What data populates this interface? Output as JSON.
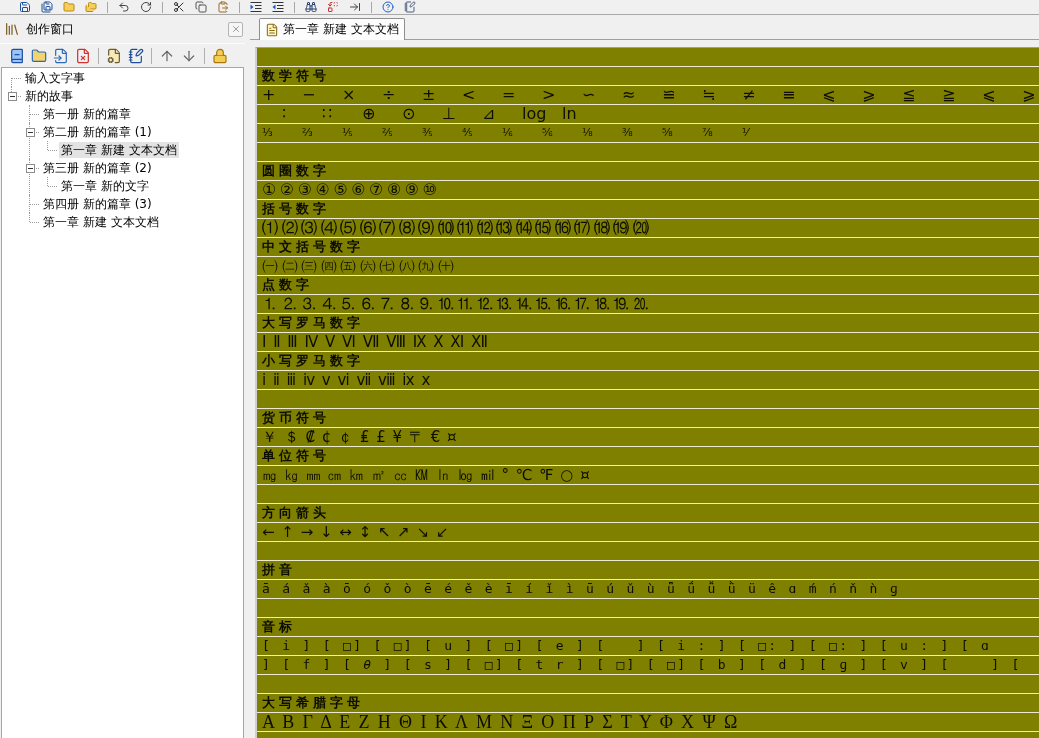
{
  "sidebar": {
    "title": "创作窗口",
    "tree": [
      {
        "label": "输入文字事",
        "selected": false
      },
      {
        "label": "新的故事",
        "selected": false,
        "expanded": true,
        "children": [
          {
            "label": "第一册 新的篇章",
            "selected": false
          },
          {
            "label": "第二册 新的篇章 (1)",
            "selected": false,
            "expanded": true,
            "children": [
              {
                "label": "第一章 新建 文本文档",
                "selected": true
              }
            ]
          },
          {
            "label": "第三册 新的篇章 (2)",
            "selected": false,
            "expanded": true,
            "children": [
              {
                "label": "第一章 新的文字",
                "selected": false
              }
            ]
          },
          {
            "label": "第四册 新的篇章 (3)",
            "selected": false
          },
          {
            "label": "第一章 新建 文本文档",
            "selected": false
          }
        ]
      }
    ]
  },
  "tabs": [
    {
      "label": "第一章 新建 文本文档",
      "selected": true
    }
  ],
  "document": {
    "lines": [
      {
        "kind": "blank"
      },
      {
        "kind": "heading",
        "text": "数学符号"
      },
      {
        "kind": "symbols",
        "items": [
          "+",
          "−",
          "×",
          "÷",
          "±",
          "<",
          "=",
          ">",
          "∽",
          "≈",
          "≌",
          "≒",
          "≠",
          "≡",
          "⩽",
          "⩾",
          "≦",
          "≧",
          "⩽",
          "⩾"
        ]
      },
      {
        "kind": "symbols-shifted",
        "items": [
          "∶",
          "∷",
          "⊕",
          "⊙",
          "⊥",
          "⊿",
          "log",
          "ln"
        ]
      },
      {
        "kind": "fractions",
        "items": [
          "⅓",
          "⅔",
          "⅕",
          "⅖",
          "⅗",
          "⅘",
          "⅙",
          "⅚",
          "⅛",
          "⅜",
          "⅝",
          "⅞",
          "⅟"
        ]
      },
      {
        "kind": "blank"
      },
      {
        "kind": "heading",
        "text": "圆圈数字"
      },
      {
        "kind": "glyphs",
        "text": "①②③④⑤⑥⑦⑧⑨⑩"
      },
      {
        "kind": "heading",
        "text": "括号数字"
      },
      {
        "kind": "glyphs",
        "text": "⑴⑵⑶⑷⑸⑹⑺⑻⑼⑽⑾⑿⒀⒁⒂⒃⒄⒅⒆⒇"
      },
      {
        "kind": "heading",
        "text": "中文括号数字"
      },
      {
        "kind": "glyphs",
        "text": "㈠㈡㈢㈣㈤㈥㈦㈧㈨㈩"
      },
      {
        "kind": "heading",
        "text": "点数字"
      },
      {
        "kind": "glyphs",
        "text": "⒈⒉⒊⒋⒌⒍⒎⒏⒐⒑⒒⒓⒔⒕⒖⒗⒘⒙⒚⒛"
      },
      {
        "kind": "heading",
        "text": "大写罗马数字"
      },
      {
        "kind": "spaced-glyphs",
        "text": "Ⅰ Ⅱ Ⅲ Ⅳ Ⅴ Ⅵ Ⅶ Ⅷ Ⅸ Ⅹ Ⅺ Ⅻ"
      },
      {
        "kind": "heading",
        "text": "小写罗马数字"
      },
      {
        "kind": "spaced-glyphs",
        "text": "ⅰ ⅱ ⅲ ⅳ ⅴ ⅵ ⅶ ⅷ ⅸ ⅹ"
      },
      {
        "kind": "blank"
      },
      {
        "kind": "heading",
        "text": "货币符号"
      },
      {
        "kind": "spaced-glyphs",
        "text": "￥ ＄ ₡ ¢ ￠ ₤ £ ¥ 〒 € ¤"
      },
      {
        "kind": "heading",
        "text": "单位符号"
      },
      {
        "kind": "spaced-glyphs",
        "text": "㎎ ㎏ ㎜ ㎝ ㎞ ㎡ ㏄ ㏎ ㏑ ㏒ ㏕ ° ℃ ℉ ○ ¤"
      },
      {
        "kind": "blank"
      },
      {
        "kind": "heading",
        "text": "方向箭头"
      },
      {
        "kind": "spaced-glyphs",
        "text": "← ↑ → ↓ ↔ ↕ ↖ ↗ ↘ ↙"
      },
      {
        "kind": "blank"
      },
      {
        "kind": "heading",
        "text": "拼音"
      },
      {
        "kind": "mono",
        "text": "ā á ǎ à ō ó ǒ ò ē é ě è ī í ǐ ì ū ú ǔ ù ǖ ǘ ǚ ǜ ü ê ɑ ḿ ń ň ǹ ɡ"
      },
      {
        "kind": "blank"
      },
      {
        "kind": "heading",
        "text": "音标"
      },
      {
        "kind": "mono",
        "text": "[ i ] [ □] [ □] [ u ] [ □] [ e ] [   ] [ i : ] [ □: ] [ □: ] [ u : ] [ ɑ"
      },
      {
        "kind": "mono",
        "text": "] [ f ] [ *θ* ] [ s ] [ □] [ t r ] [ □] [ □] [ b ] [ d ] [ ɡ ] [ v ] [    ] ["
      },
      {
        "kind": "blank"
      },
      {
        "kind": "heading",
        "text": "大写希腊字母"
      },
      {
        "kind": "greek",
        "text": "Α Β Γ Δ Ε Ζ Η Θ Ι Κ Λ Μ Ν Ξ Ο Π Ρ Σ Τ Υ Φ Χ Ψ Ω"
      }
    ]
  }
}
